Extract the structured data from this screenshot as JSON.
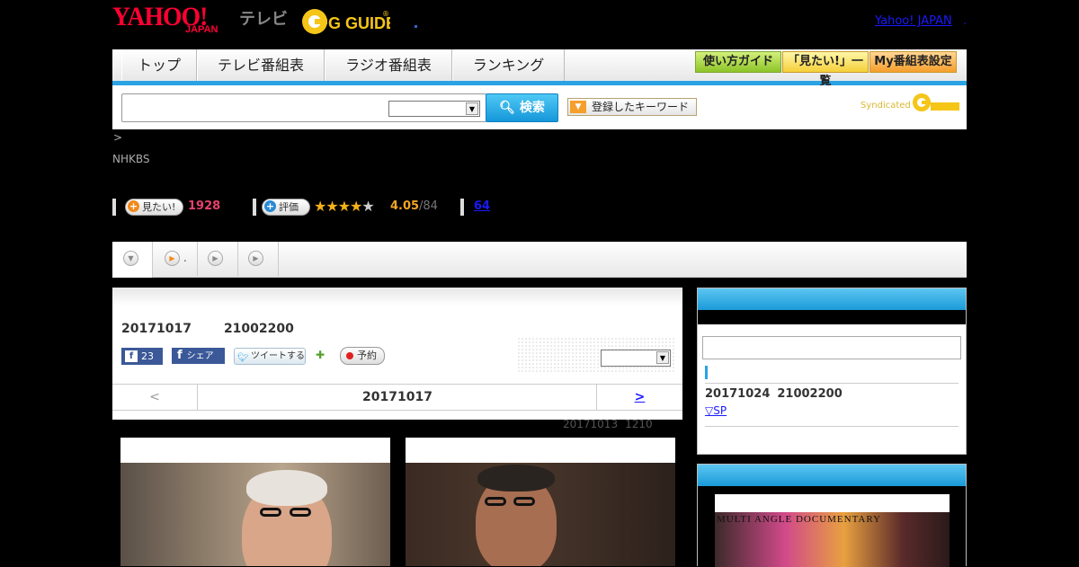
{
  "header": {
    "yahoo_logo": "YAHOO!",
    "japan_logo": "JAPAN",
    "tv_label": "テレビ",
    "gguide_logo": "G GUIDE",
    "top_link": "Yahoo! JAPAN",
    "top_link_suffix": "."
  },
  "nav": {
    "items": [
      "トップ",
      "テレビ番組表",
      "ラジオ番組表",
      "ランキング"
    ],
    "buttons": [
      "使い方ガイド",
      "「見たい!」一覧",
      "My番組表設定"
    ]
  },
  "search": {
    "button_label": "検索",
    "keyword_button": "登録したキーワード",
    "syndicated_label": "Syndicated"
  },
  "breadcrumb": ">",
  "channel": "NHKBS",
  "stats": {
    "want_label": "見たい!",
    "want_count": "1928",
    "rate_label": "評価",
    "rating": "4.05",
    "rating_count": "/84",
    "rating_value": 4.05,
    "review_count": "64"
  },
  "tabs": {
    "dot": "."
  },
  "program": {
    "date": "20171017",
    "time": "21002200",
    "fb_count": "23",
    "fb_share": "シェア",
    "tweet": "ツイートする",
    "reserve": "予約"
  },
  "pager": {
    "prev": "<",
    "date": "20171017",
    "next": ">"
  },
  "updated": {
    "date": "20171013",
    "time": "1210"
  },
  "sidebar": {
    "date": "20171024",
    "time": "21002200",
    "link": "▽SP"
  },
  "ad": {
    "text": "MULTI ANGLE DOCUMENTARY"
  },
  "colors": {
    "accent_blue": "#2aa3e5",
    "yahoo_red": "#ff0033",
    "gguide_yellow": "#f5c518"
  }
}
